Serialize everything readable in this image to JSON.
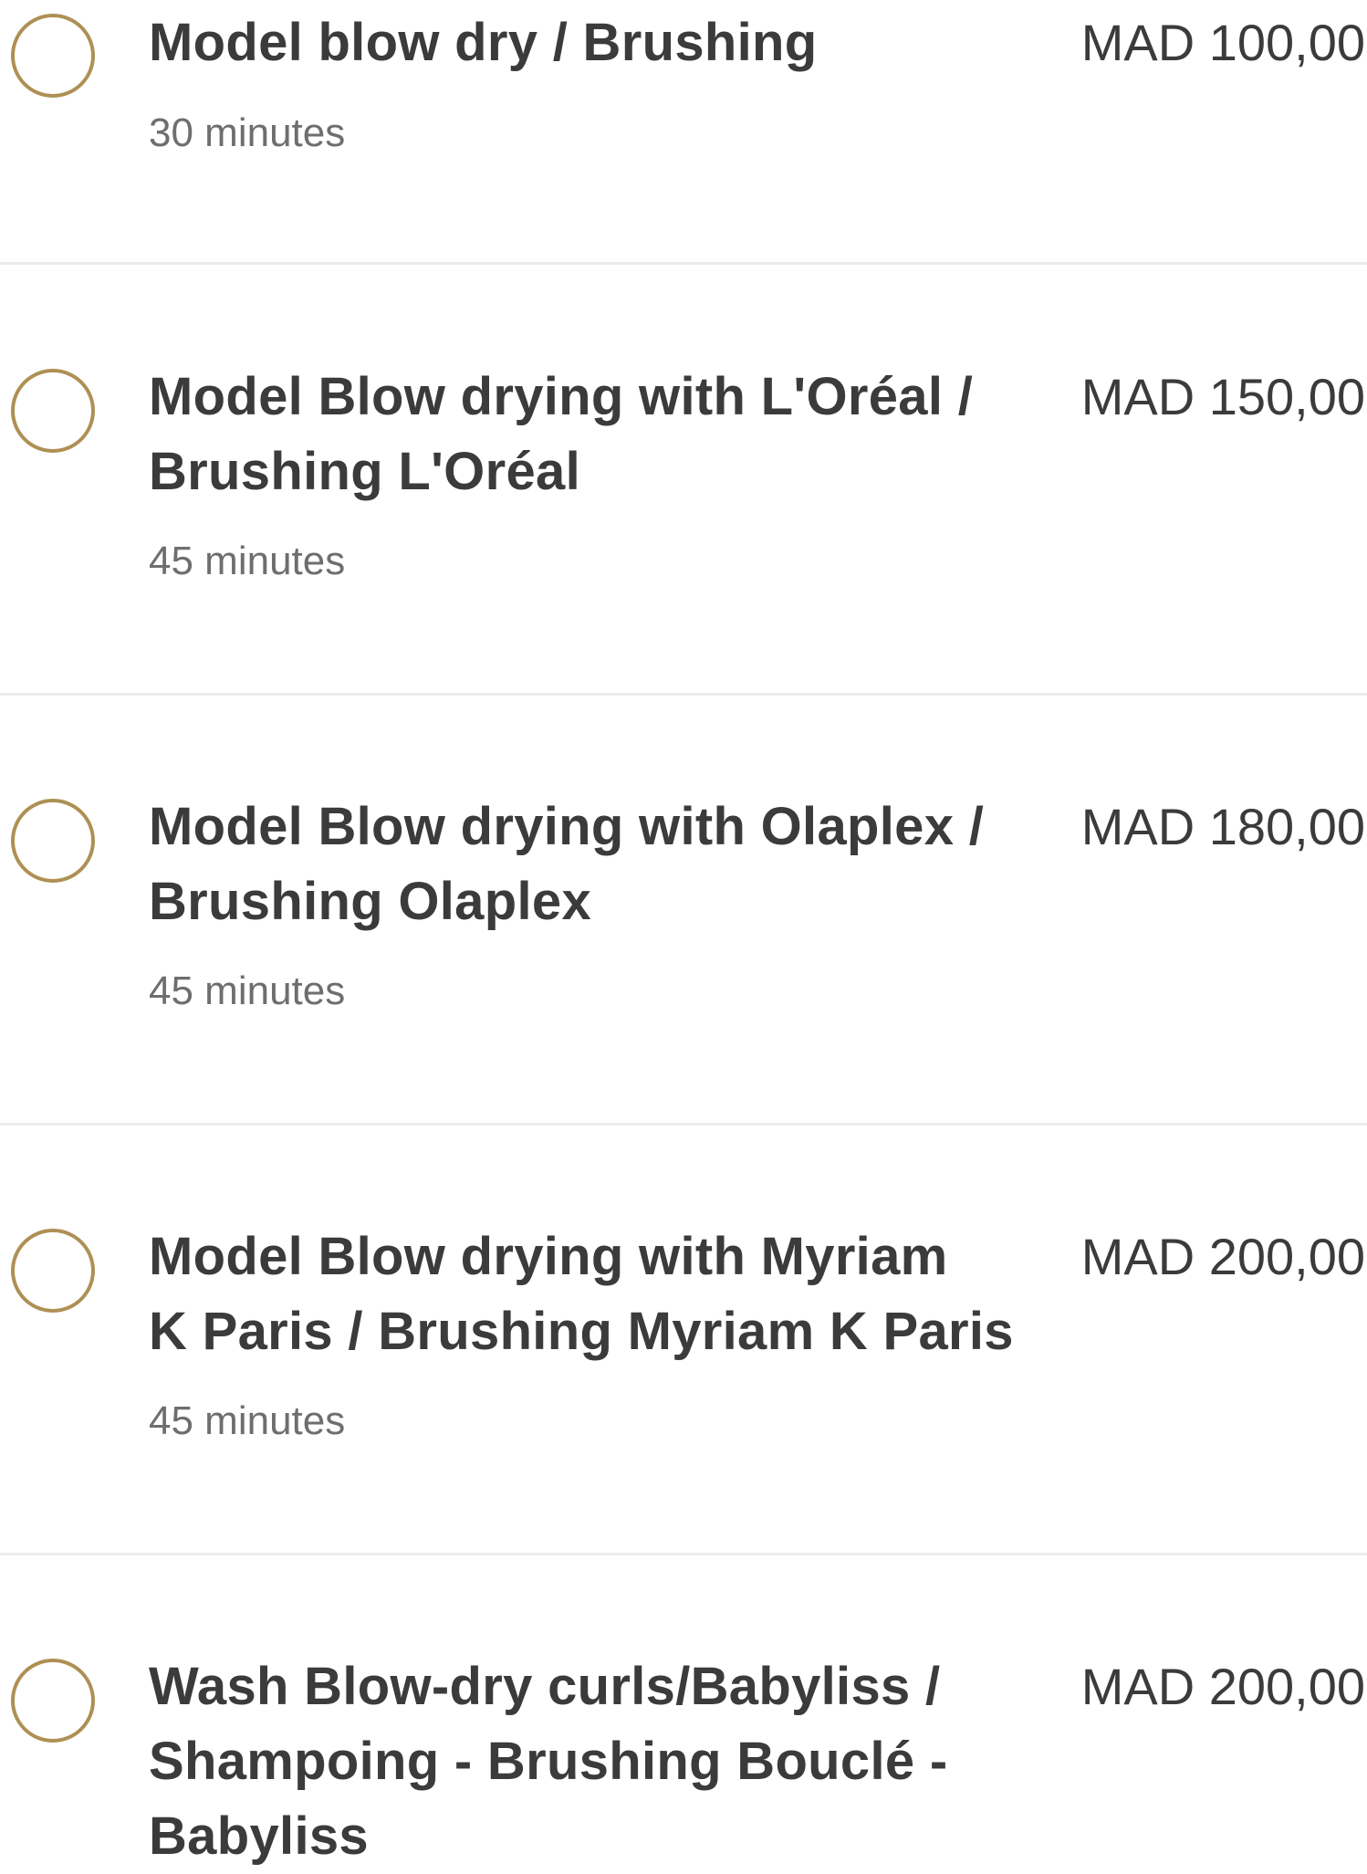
{
  "colors": {
    "radio_border": "#ae9054",
    "text_primary": "#3b3b3b",
    "text_secondary": "#6e6e6e",
    "divider": "#ececec"
  },
  "services": [
    {
      "name_lines": [
        "Model blow dry / Brushing"
      ],
      "duration": "30 minutes",
      "price": "MAD 100,00",
      "selected": false
    },
    {
      "name_lines": [
        "Model Blow drying with L'Oréal /",
        "Brushing L'Oréal"
      ],
      "duration": "45 minutes",
      "price": "MAD 150,00",
      "selected": false
    },
    {
      "name_lines": [
        "Model Blow drying with Olaplex /",
        "Brushing Olaplex"
      ],
      "duration": "45 minutes",
      "price": "MAD 180,00",
      "selected": false
    },
    {
      "name_lines": [
        "Model Blow drying with Myriam",
        "K Paris / Brushing Myriam K Paris"
      ],
      "duration": "45 minutes",
      "price": "MAD 200,00",
      "selected": false
    },
    {
      "name_lines": [
        "Wash Blow-dry curls/Babyliss /",
        "Shampoing - Brushing Bouclé -",
        "Babyliss"
      ],
      "duration": "",
      "price": "MAD 200,00",
      "selected": false
    }
  ]
}
